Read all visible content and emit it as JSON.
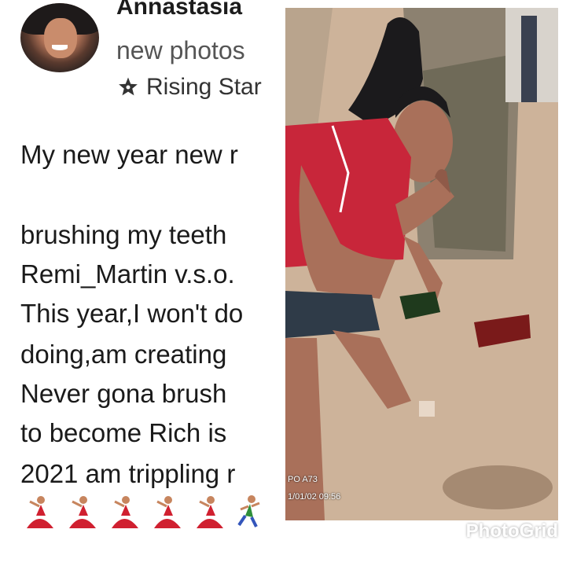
{
  "post": {
    "username": "Annastasia",
    "subtitle": "new photos",
    "badge": "Rising Star",
    "lines": [
      "My new year new r",
      "brushing my teeth",
      "Remi_Martin v.s.o.",
      "This year,I won't do",
      "doing,am  creating",
      "Never gona brush",
      "to become Rich is",
      "2021 am trippling r"
    ],
    "emoji": [
      "dancer-emoji",
      "dancer-emoji",
      "dancer-emoji",
      "dancer-emoji",
      "dancer-emoji",
      "runner-emoji"
    ]
  },
  "photo": {
    "camera_label": "PO A73",
    "timestamp": "1/01/02 09:56"
  },
  "watermark": {
    "label": "PhotoGrid"
  },
  "colors": {
    "shirt": "#c8263a",
    "hair": "#1b1a1c",
    "skin": "#a9705a",
    "ground": "#c7a987",
    "bottle": "#1f3a1d",
    "box": "#7a1a1a"
  }
}
